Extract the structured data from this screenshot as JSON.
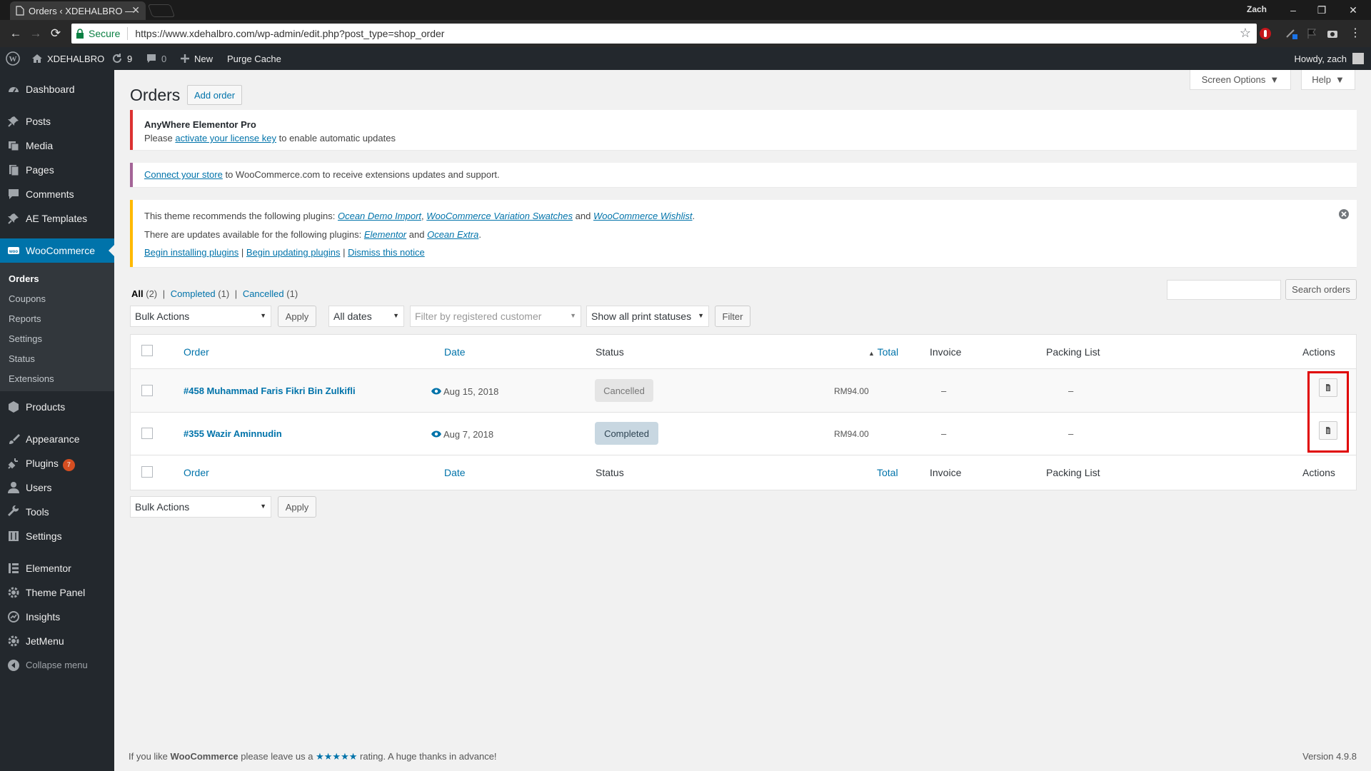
{
  "browser": {
    "tab_title": "Orders ‹ XDEHALBRO —",
    "window_user": "Zach",
    "secure_label": "Secure",
    "url": "https://www.xdehalbro.com/wp-admin/edit.php?post_type=shop_order"
  },
  "adminbar": {
    "site_name": "XDEHALBRO",
    "updates_count": "9",
    "comments_count": "0",
    "new_label": "New",
    "purge_cache": "Purge Cache",
    "howdy": "Howdy, zach"
  },
  "sidebar": {
    "items": [
      {
        "label": "Dashboard",
        "icon": "dashboard-icon"
      },
      {
        "label": "Posts",
        "icon": "pin-icon"
      },
      {
        "label": "Media",
        "icon": "media-icon"
      },
      {
        "label": "Pages",
        "icon": "pages-icon"
      },
      {
        "label": "Comments",
        "icon": "comment-icon"
      },
      {
        "label": "AE Templates",
        "icon": "pin-icon"
      },
      {
        "label": "WooCommerce",
        "icon": "woocommerce-icon"
      },
      {
        "label": "Products",
        "icon": "box-icon"
      },
      {
        "label": "Appearance",
        "icon": "brush-icon"
      },
      {
        "label": "Plugins",
        "icon": "plug-icon",
        "badge": "7"
      },
      {
        "label": "Users",
        "icon": "user-icon"
      },
      {
        "label": "Tools",
        "icon": "wrench-icon"
      },
      {
        "label": "Settings",
        "icon": "sliders-icon"
      },
      {
        "label": "Elementor",
        "icon": "elementor-icon"
      },
      {
        "label": "Theme Panel",
        "icon": "gear-icon"
      },
      {
        "label": "Insights",
        "icon": "insights-icon"
      },
      {
        "label": "JetMenu",
        "icon": "gear-icon"
      },
      {
        "label": "Collapse menu",
        "icon": "collapse-icon"
      }
    ],
    "woo_submenu": [
      "Orders",
      "Coupons",
      "Reports",
      "Settings",
      "Status",
      "Extensions"
    ]
  },
  "header": {
    "title": "Orders",
    "add_order": "Add order",
    "screen_options": "Screen Options",
    "help": "Help"
  },
  "notices": {
    "elementor_title": "AnyWhere Elementor Pro",
    "elementor_pre": "Please",
    "elementor_link": "activate your license key",
    "elementor_post": "to enable automatic updates",
    "connect_link": "Connect your store",
    "connect_post": "to WooCommerce.com to receive extensions updates and support.",
    "theme_pre": "This theme recommends the following plugins:",
    "plugin_1": "Ocean Demo Import",
    "comma": ",",
    "plugin_2": "WooCommerce Variation Swatches",
    "and": "and",
    "plugin_3": "WooCommerce Wishlist",
    "period": ".",
    "updates_pre": "There are updates available for the following plugins:",
    "update_1": "Elementor",
    "update_2": "Ocean Extra",
    "begin_installing": "Begin installing plugins",
    "pipe": "|",
    "begin_updating": "Begin updating plugins",
    "dismiss": "Dismiss this notice"
  },
  "filters": {
    "all": "All",
    "all_count": "(2)",
    "completed": "Completed",
    "completed_count": "(1)",
    "cancelled": "Cancelled",
    "cancelled_count": "(1)",
    "pipe": "|",
    "search_button": "Search orders",
    "bulk_actions": "Bulk Actions",
    "apply": "Apply",
    "all_dates": "All dates",
    "customer_placeholder": "Filter by registered customer",
    "print_statuses": "Show all print statuses",
    "filter": "Filter"
  },
  "table": {
    "columns": [
      "Order",
      "Date",
      "Status",
      "Total",
      "Invoice",
      "Packing List",
      "Actions"
    ],
    "rows": [
      {
        "order": "#458 Muhammad Faris Fikri Bin Zulkifli",
        "date": "Aug 15, 2018",
        "status": "Cancelled",
        "total": "RM94.00",
        "invoice": "–",
        "packing": "–"
      },
      {
        "order": "#355 Wazir Aminnudin",
        "date": "Aug 7, 2018",
        "status": "Completed",
        "total": "RM94.00",
        "invoice": "–",
        "packing": "–"
      }
    ]
  },
  "colors": {
    "accent": "#0073aa",
    "sidebar": "#23282d",
    "status_cancelled": "#e5e5e5",
    "status_completed": "#c8d7e1",
    "highlight": "#e00000"
  },
  "footer": {
    "pre": "If you like",
    "brand": "WooCommerce",
    "mid": "please leave us a",
    "stars": "★★★★★",
    "post": "rating. A huge thanks in advance!",
    "version": "Version 4.9.8"
  }
}
